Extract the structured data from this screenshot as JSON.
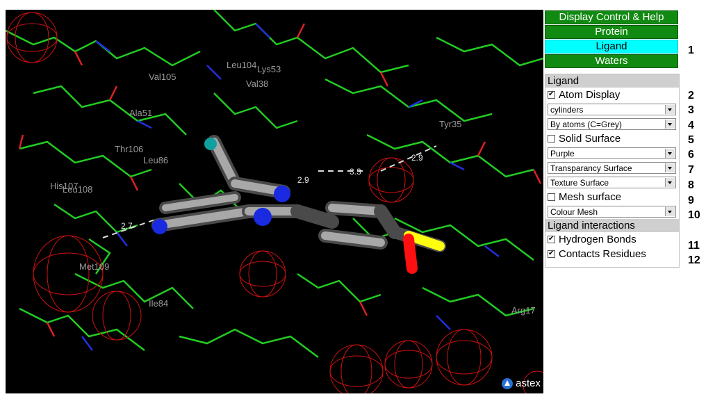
{
  "viewer": {
    "residue_labels": [
      "Leu104",
      "Lys53",
      "Val105",
      "Val38",
      "Ala51",
      "Tyr35",
      "Thr106",
      "Leu86",
      "His107",
      "Leu108",
      "Met109",
      "Ile84",
      "Arg17"
    ],
    "distance_labels": [
      "2.9",
      "3.3",
      "2.9",
      "2.7"
    ],
    "logo_text": "astex"
  },
  "panel": {
    "header_buttons": [
      "Display Control & Help",
      "Protein",
      "Ligand",
      "Waters"
    ],
    "active_button": "Ligand",
    "ligand_section_title": "Ligand",
    "atom_display_label": "Atom Display",
    "atom_display_checked": true,
    "style_select": "cylinders",
    "colour_select": "By atoms (C=Grey)",
    "solid_surface_label": "Solid Surface",
    "solid_surface_checked": false,
    "surface_colour_select": "Purple",
    "transparency_select": "Transparancy Surface",
    "texture_select": "Texture Surface",
    "mesh_surface_label": "Mesh surface",
    "mesh_surface_checked": false,
    "mesh_colour_select": "Colour Mesh",
    "interactions_title": "Ligand interactions",
    "hbonds_label": "Hydrogen Bonds",
    "hbonds_checked": true,
    "contacts_label": "Contacts Residues",
    "contacts_checked": true
  },
  "row_numbers": [
    "1",
    "2",
    "3",
    "4",
    "5",
    "6",
    "7",
    "8",
    "9",
    "10",
    "11",
    "12"
  ],
  "colors": {
    "button_green": "#118a11",
    "active_cyan": "#00ffff",
    "protein_green": "#22cc22",
    "mesh_red": "#d01010"
  }
}
